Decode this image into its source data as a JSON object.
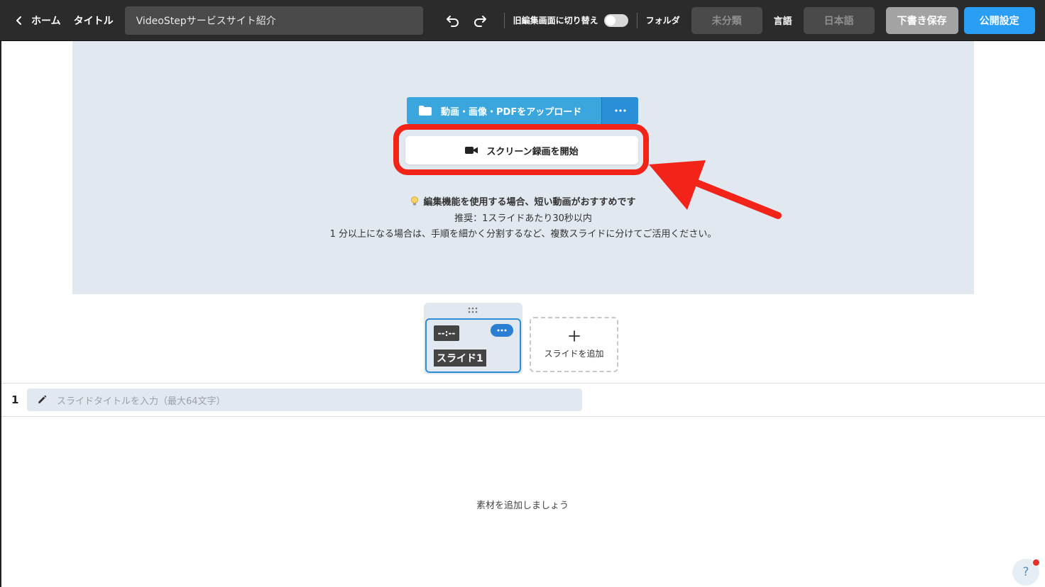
{
  "topbar": {
    "home_label": "ホーム",
    "title_label": "タイトル",
    "title_value": "VideoStepサービスサイト紹介",
    "legacy_editor_label": "旧編集画面に切り替え",
    "legacy_editor_enabled": false,
    "folder_label": "フォルダ",
    "folder_value": "未分類",
    "language_label": "言語",
    "language_value": "日本語",
    "draft_save_label": "下書き保存",
    "publish_settings_label": "公開設定"
  },
  "stage": {
    "upload_label": "動画・画像・PDFをアップロード",
    "record_label": "スクリーン録画を開始",
    "tip_title": "編集機能を使用する場合、短い動画がおすすめです",
    "tip_recommend": "推奨：1スライドあたり30秒以内",
    "tip_detail": "1 分以上になる場合は、手順を細かく分割するなど、複数スライドに分けてご活用ください。"
  },
  "slides": {
    "items": [
      {
        "duration": "--:--",
        "name": "スライド1"
      }
    ],
    "add_label": "スライドを追加"
  },
  "slide_editor": {
    "number": "1",
    "title_placeholder": "スライドタイトルを入力（最大64文字）",
    "empty_message": "素材を追加しましょう"
  },
  "help": {
    "label": "?"
  },
  "colors": {
    "topbar_bg": "#2b2b2b",
    "stage_bg": "#e1e8ef",
    "upload_blue": "#3aa6dd",
    "publish_blue": "#2a9df4",
    "highlight_red": "#f2241a"
  },
  "icons": {
    "back": "chevron-left-icon",
    "undo": "undo-icon",
    "redo": "redo-icon",
    "upload": "folder-icon",
    "more": "more-horizontal-icon",
    "record": "video-camera-icon",
    "tip": "lightbulb-icon",
    "drag": "drag-handle-icon",
    "add": "plus-icon",
    "edit": "pencil-icon"
  }
}
